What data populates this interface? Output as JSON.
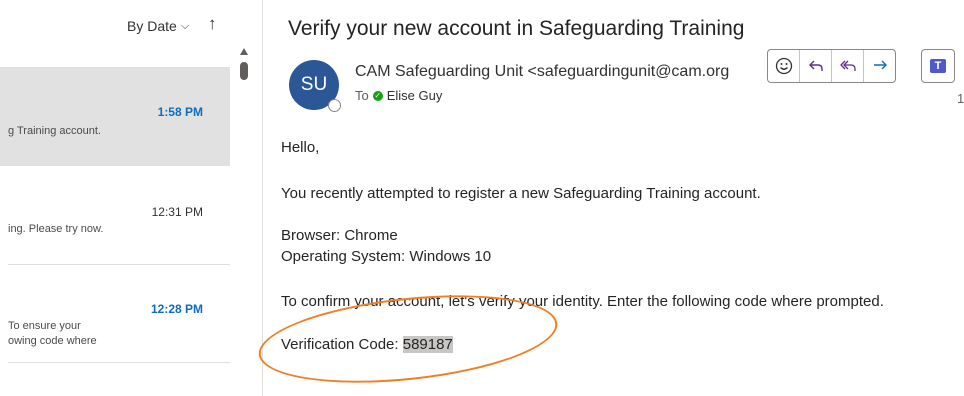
{
  "list": {
    "sort_label": "By Date",
    "messages": [
      {
        "time": "1:58 PM",
        "preview": [
          "g Training account."
        ]
      },
      {
        "time": "12:31 PM",
        "preview": [
          "ing. Please try now."
        ]
      },
      {
        "time": "12:28 PM",
        "preview": [
          "To ensure your",
          "owing code where"
        ]
      }
    ]
  },
  "email": {
    "subject": "Verify your new account in Safeguarding Training",
    "avatar_initials": "SU",
    "sender": "CAM Safeguarding Unit <safeguardingunit@cam.org",
    "to_label": "To",
    "recipient": "Elise Guy",
    "overflow_count": "1",
    "body": {
      "greeting": "Hello,",
      "line1": "You recently attempted to register a new Safeguarding Training account.",
      "browser": "Browser: Chrome",
      "os": "Operating System: Windows 10",
      "instruction": "To confirm your account, let's verify your identity. Enter the following code where prompted.",
      "code_label": "Verification Code: ",
      "code": "589187"
    }
  },
  "toolbar": {
    "icons": [
      "smiley-icon",
      "reply-icon",
      "reply-all-icon",
      "forward-icon",
      "teams-icon"
    ]
  },
  "colors": {
    "accent": "#0f6cbd",
    "avatar": "#2b5797",
    "selected_bg": "#e1e1e1",
    "highlight_ring": "#f07f24",
    "code_highlight": "#c8c6c4"
  }
}
